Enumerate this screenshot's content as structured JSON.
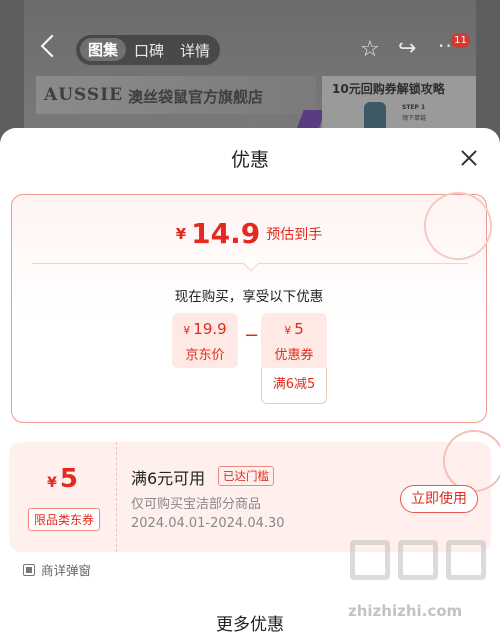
{
  "background": {
    "tabs": [
      "图集",
      "口碑",
      "详情"
    ],
    "selected_tab": "图集",
    "notification_count": "11",
    "brand_logo": "AUSSIE",
    "brand_store": "澳丝袋鼠官方旗舰店",
    "promo_title": "10元回购券解锁攻略",
    "promo_step": "STEP 1",
    "promo_step_text": "领下单链"
  },
  "sheet": {
    "title": "优惠",
    "summary": {
      "currency": "¥",
      "final_price": "14.9",
      "final_label": "预估到手",
      "intro": "现在购买，享受以下优惠",
      "base_price": "19.9",
      "base_label": "京东价",
      "minus": "−",
      "discount": "5",
      "discount_label": "优惠券",
      "discount_rule": "满6减5"
    },
    "coupon": {
      "currency": "¥",
      "value": "5",
      "type": "限品类东券",
      "condition": "满6元可用",
      "status": "已达门槛",
      "scope": "仅可购买宝洁部分商品",
      "validity": "2024.04.01-2024.04.30",
      "action": "立即使用"
    },
    "popup_option": "商详弹窗",
    "more_title": "更多优惠"
  },
  "watermark": {
    "glyphs": "值值值",
    "site": "zhizhizhi.com"
  },
  "colors": {
    "accent": "#e22b1e",
    "accent_light": "#ffe9e5",
    "border": "#f09b8f"
  }
}
